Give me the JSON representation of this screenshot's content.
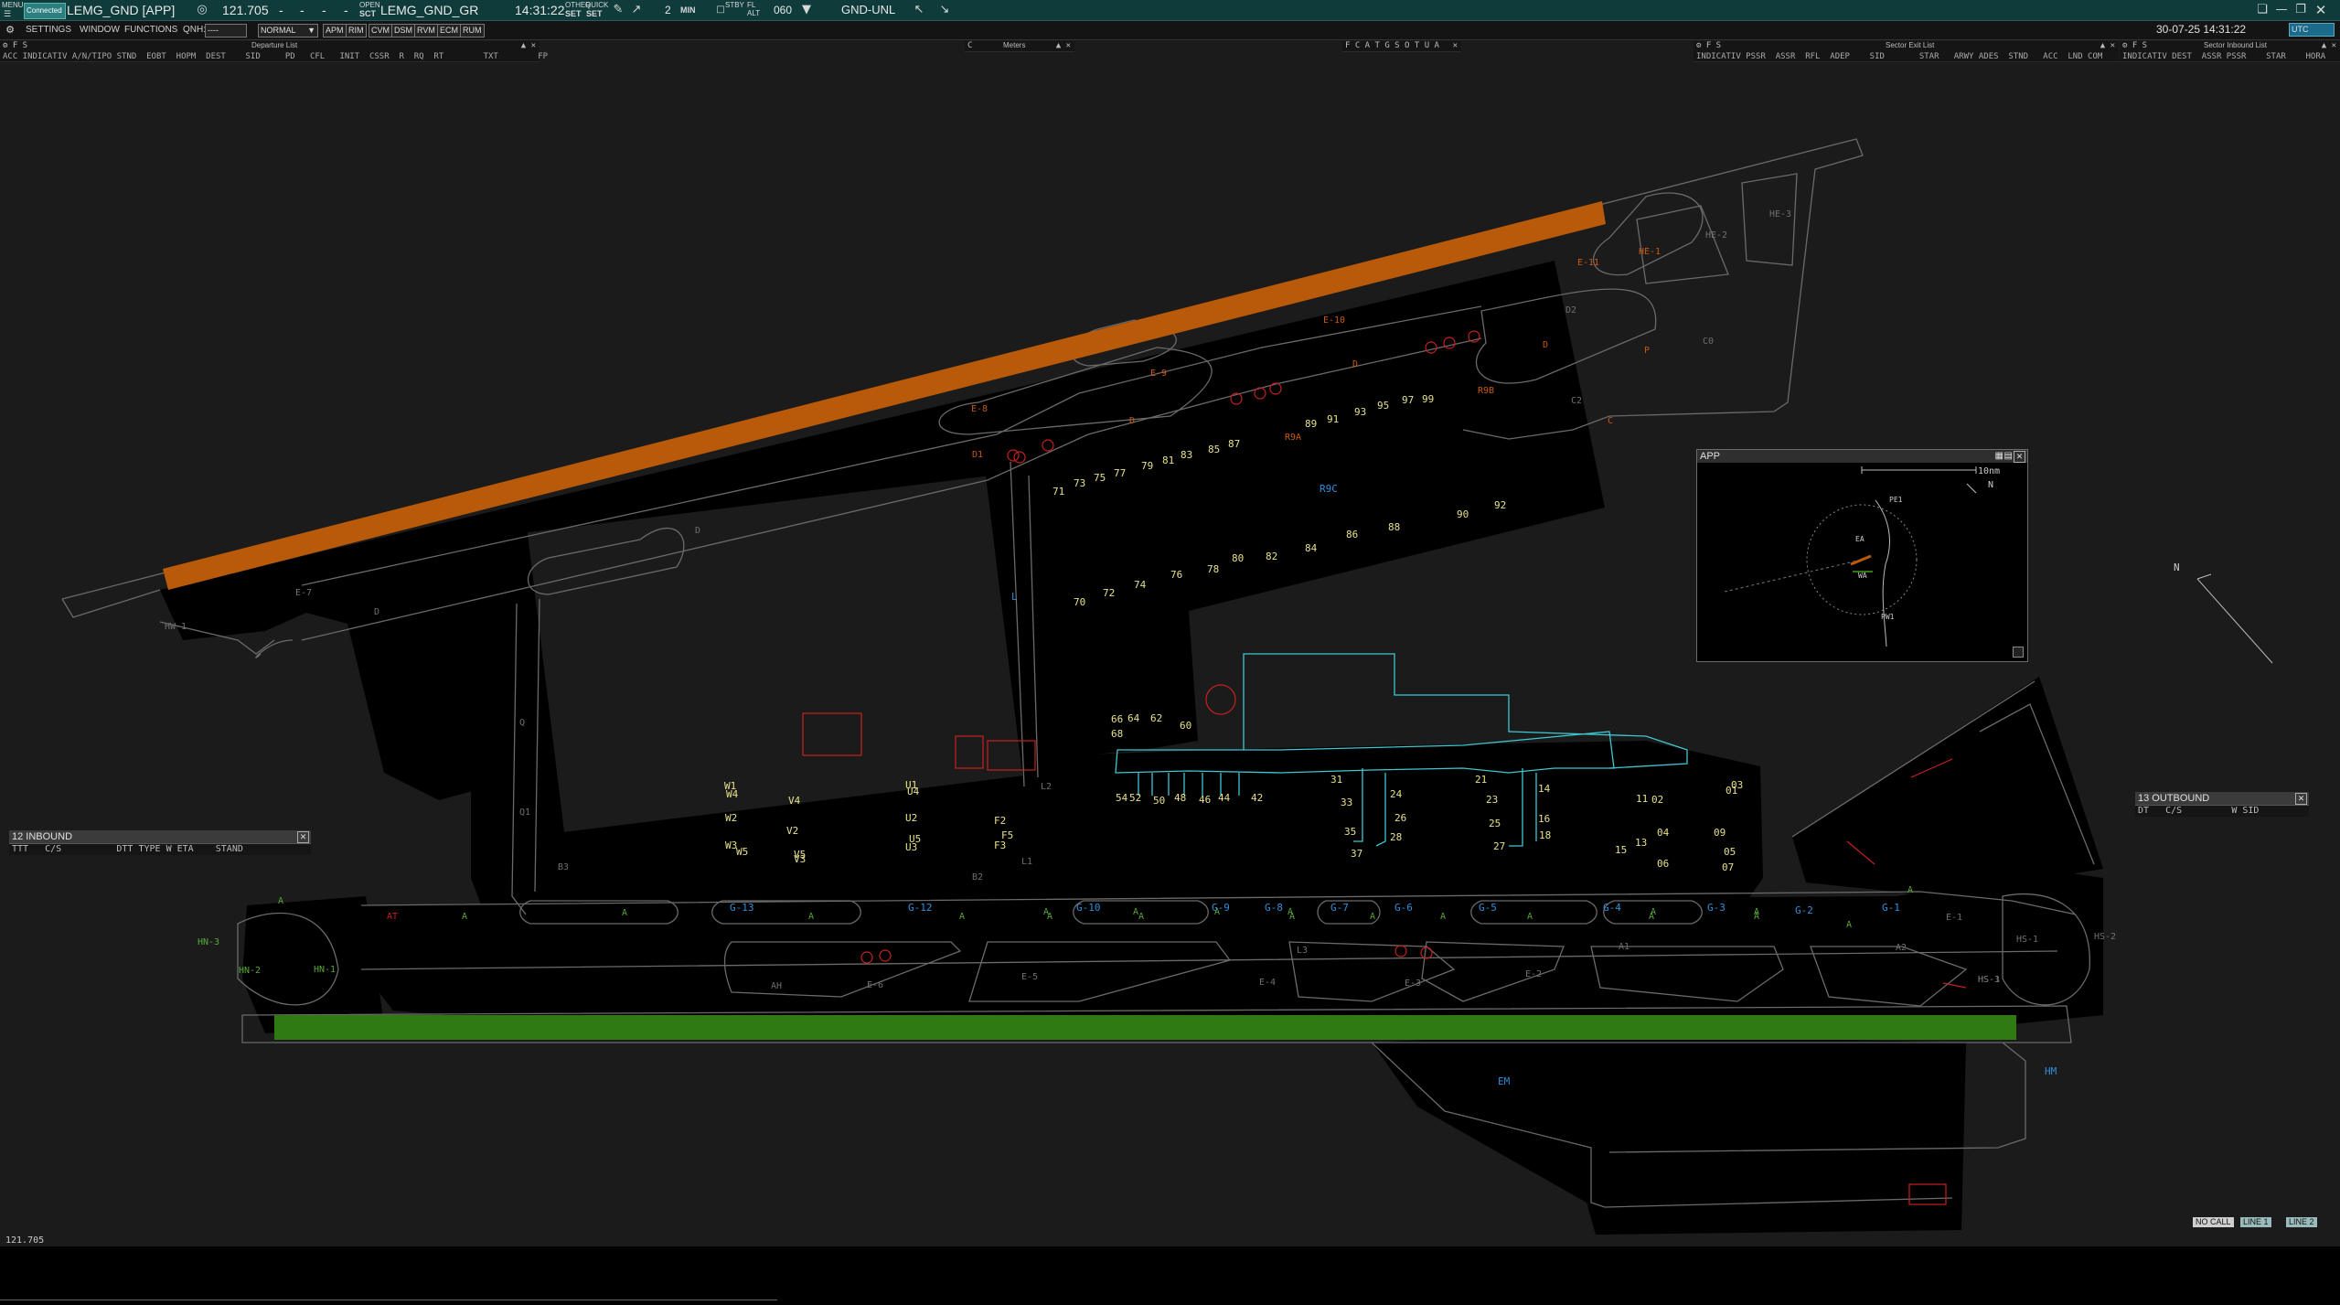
{
  "topbar": {
    "menu_label": "MENU",
    "connection_status": "Connected",
    "position_title": "LEMG_GND [APP]",
    "frequency": "121.705",
    "dash_fields": [
      "-",
      "-",
      "-",
      "-"
    ],
    "open_label": "OPEN",
    "sct_label": "SCT",
    "sector_name": "LEMG_GND_GR",
    "clock": "14:31:22",
    "other_label": "OTHER",
    "quick_label": "QUICK",
    "set_label_1": "SET",
    "set_label_2": "SET",
    "min_value": "2",
    "min_label": "MIN",
    "stby_label": "STBY",
    "fl_label": "FL",
    "alt_label": "ALT",
    "heading_value": "060",
    "sector_mode": "GND-UNL",
    "datetime": "30-07-25 14:31:22",
    "utc_label": "UTC"
  },
  "menubar": {
    "settings": "SETTINGS",
    "window": "WINDOW",
    "functions": "FUNCTIONS",
    "qnh_label": "QNH:",
    "qnh_value": "----",
    "mode_select": "NORMAL",
    "buttons": [
      "APM",
      "RIM",
      "CVM",
      "DSM",
      "RVM",
      "ECM",
      "RUM"
    ]
  },
  "lists": {
    "departure": {
      "title": "Departure List",
      "left": "⚙ F S",
      "columns": "ACC INDICATIV A/N/TIPO STND  EOBT  HOPM  DEST    SID     PD   CFL   INIT  CSSR  R  RQ  RT        TXT        FP"
    },
    "meters": {
      "title": "Meters",
      "left": "C"
    },
    "filters": {
      "left": "F C A T G S O T U A"
    },
    "sector_exit": {
      "title": "Sector Exit List",
      "left": "⚙ F S",
      "columns": "INDICATIV PSSR  ASSR  RFL  ADEP    SID       STAR   ARWY ADES  STND   ACC  LND COM"
    },
    "sector_inbound": {
      "title": "Sector Inbound List",
      "left": "⚙ F S",
      "columns": "INDICATIV DEST  ASSR PSSR    STAR    HORA"
    }
  },
  "inbound_panel": {
    "title": "12  INBOUND",
    "columns": "TTT   C/S          DTT TYPE W ETA    STAND"
  },
  "outbound_panel": {
    "title": "13  OUTBOUND",
    "columns": "DT   C/S         W SID"
  },
  "app_panel": {
    "title": "APP",
    "range": "10nm",
    "north": "N",
    "labels": [
      "PE1",
      "EA",
      "WA",
      "PW1"
    ]
  },
  "compass": {
    "label": "N"
  },
  "bottom": {
    "frequency_readout": "121.705",
    "no_call": "NO CALL",
    "line_1": "LINE 1",
    "line_2": "LINE 2"
  },
  "map": {
    "colors": {
      "runway_north": "#b85a0a",
      "runway_south": "#2f7a12",
      "taxiway_label": "#2f8fd8",
      "apron_label": "#58a838",
      "stand_label": "#e6e08a",
      "hold_label": "#c85a10",
      "terminal_outline": "#3ec7d0",
      "hotspot": "#c62020"
    },
    "taxiway_labels": [
      "G-13",
      "G-12",
      "G-10",
      "G-9",
      "G-8",
      "G-7",
      "G-6",
      "G-5",
      "G-4",
      "G-3",
      "G-2",
      "G-1",
      "R9C",
      "L",
      "EM",
      "HM"
    ],
    "hold_labels": [
      "E-11",
      "HE-1",
      "E-10",
      "E-9",
      "E-8",
      "D",
      "D",
      "D",
      "P",
      "C",
      "R9B",
      "R9A",
      "D1"
    ],
    "grey_labels": [
      "HE-2",
      "HE-3",
      "C0",
      "C2",
      "D2",
      "HW-1",
      "E-7",
      "D",
      "D",
      "Q",
      "Q1",
      "B3",
      "B2",
      "L1",
      "L2",
      "L3",
      "A2",
      "A1",
      "AH",
      "E-6",
      "E-5",
      "E-4",
      "E-3",
      "E-2",
      "E-1",
      "HS-1",
      "HS-2",
      "HS-3",
      "HS-1"
    ],
    "green_labels": [
      "A",
      "A",
      "A",
      "A",
      "A",
      "A",
      "A",
      "A",
      "A",
      "A",
      "A",
      "A",
      "A",
      "A",
      "A",
      "A",
      "A",
      "A",
      "A",
      "A",
      "A",
      "HN-3",
      "HN-2",
      "HN-1"
    ],
    "red_labels": [
      "AT"
    ],
    "stands_north": [
      "71",
      "73",
      "75",
      "77",
      "79",
      "81",
      "83",
      "85",
      "87",
      "89",
      "91",
      "93",
      "95",
      "97",
      "99",
      "70",
      "72",
      "74",
      "76",
      "78",
      "80",
      "82",
      "84",
      "86",
      "88",
      "90",
      "92"
    ],
    "stands_apron": [
      "66",
      "64",
      "62",
      "60",
      "68",
      "54",
      "52",
      "50",
      "48",
      "46",
      "44",
      "42",
      "W1",
      "W2",
      "W3",
      "W4",
      "W5",
      "V2",
      "V3",
      "V4",
      "V5",
      "U1",
      "U2",
      "U3",
      "U4",
      "U5",
      "F2",
      "F3",
      "F5",
      "31",
      "33",
      "35",
      "37",
      "24",
      "26",
      "28",
      "21",
      "23",
      "25",
      "27",
      "14",
      "16",
      "18",
      "11",
      "02",
      "01",
      "03",
      "04",
      "09",
      "05",
      "06",
      "07",
      "13",
      "15"
    ]
  }
}
